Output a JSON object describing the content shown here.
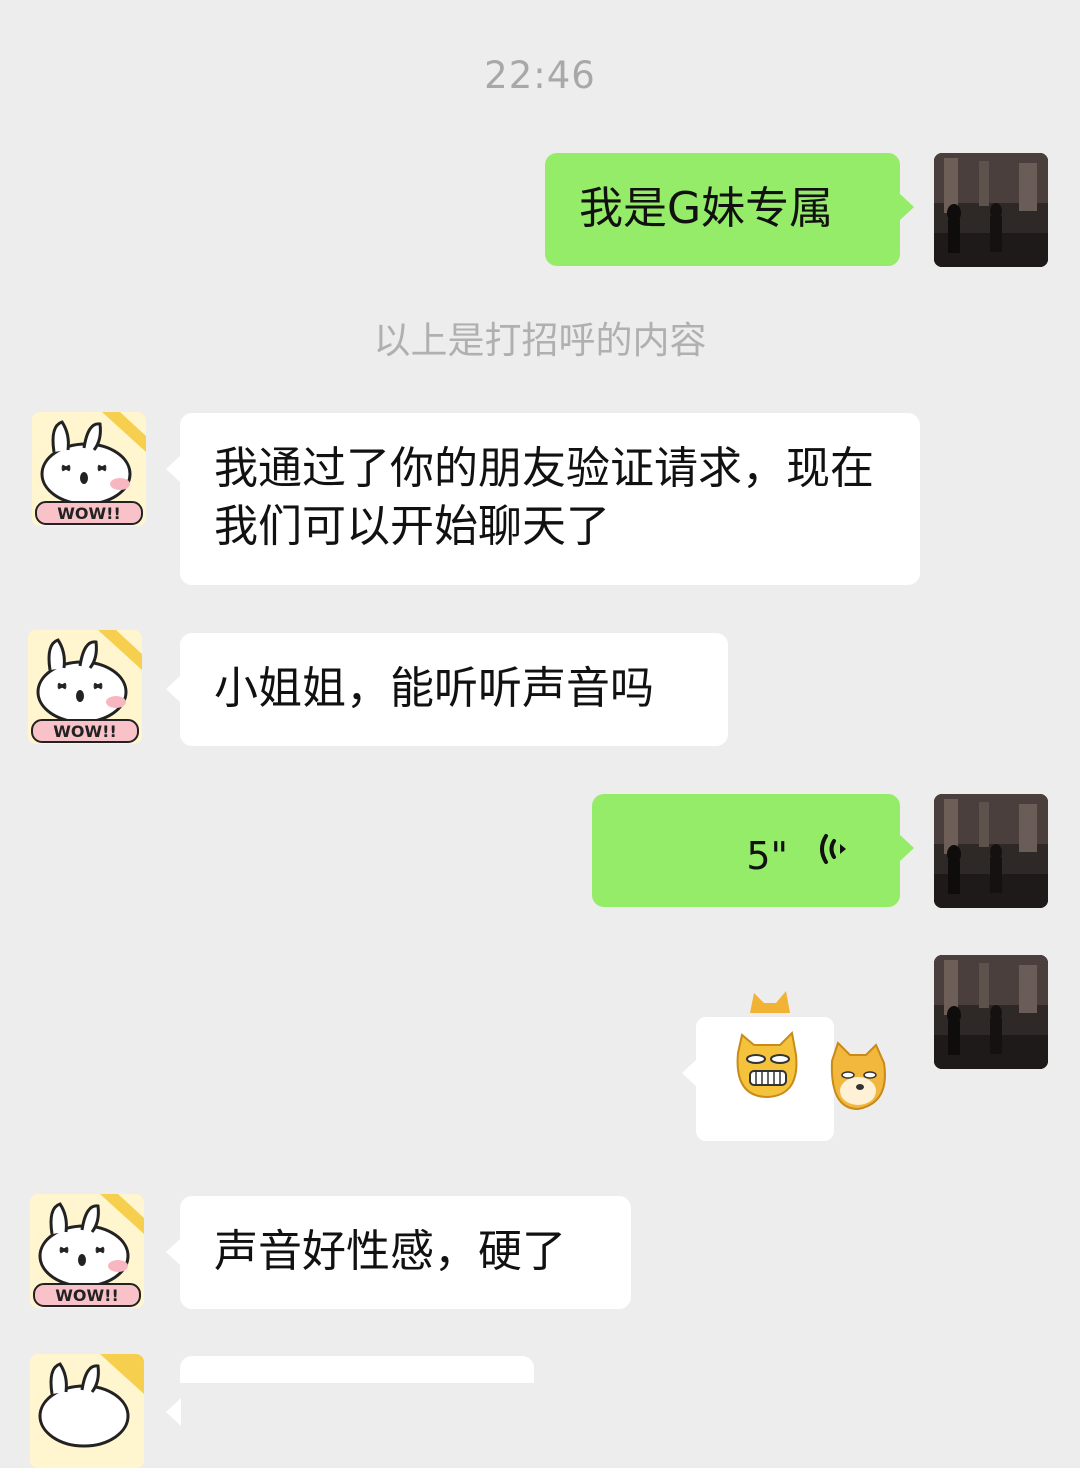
{
  "chat": {
    "timestamp": "22:46",
    "system_note": "以上是打招呼的内容",
    "messages": [
      {
        "side": "out",
        "type": "text",
        "text": "我是G妹专属"
      },
      {
        "side": "in",
        "type": "text",
        "text": "我通过了你的朋友验证请求，现在我们可以开始聊天了"
      },
      {
        "side": "in",
        "type": "text",
        "text": "小姐姐，能听听声音吗"
      },
      {
        "side": "out",
        "type": "voice",
        "duration": "5\""
      },
      {
        "side": "out",
        "type": "sticker",
        "icon": "cat-and-doge-sticker"
      },
      {
        "side": "in",
        "type": "text",
        "text": "声音好性感，硬了"
      }
    ]
  },
  "avatars": {
    "self_icon": "photo-avatar",
    "contact_icon": "bunny-wow-avatar",
    "contact_badge": "WOW!!"
  },
  "colors": {
    "background": "#ededed",
    "outgoing_bubble": "#95ec69",
    "incoming_bubble": "#ffffff"
  }
}
